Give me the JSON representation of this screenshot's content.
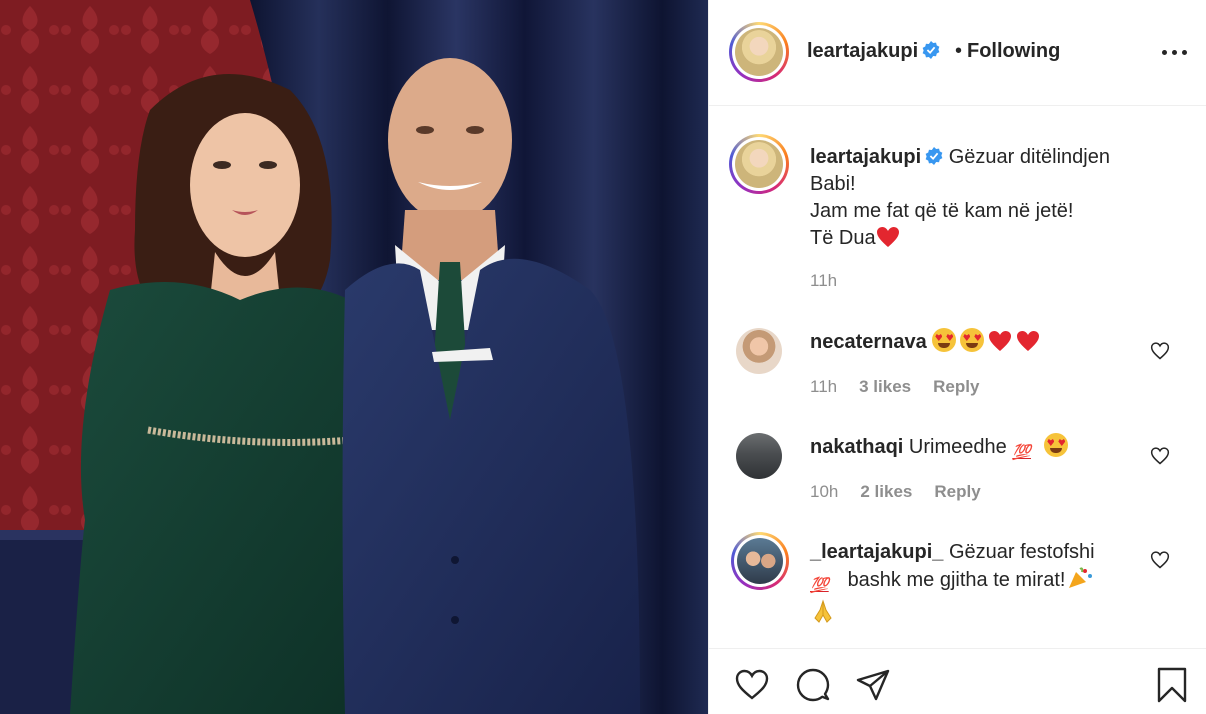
{
  "post": {
    "author": "leartajakupi",
    "follow_status": "Following",
    "separator": "•"
  },
  "caption": {
    "username": "leartajakupi",
    "lines": [
      "Gëzuar ditëlindjen",
      "Babi!",
      "Jam me fat që të kam në jetë!",
      "Të Dua"
    ],
    "time": "11h"
  },
  "comments": [
    {
      "username": "necaternava",
      "text": "",
      "time": "11h",
      "likes": "3 likes",
      "reply": "Reply"
    },
    {
      "username": "nakathaqi",
      "text": "Urimeedhe",
      "time": "10h",
      "likes": "2 likes",
      "reply": "Reply"
    },
    {
      "username": "_leartajakupi_",
      "text": "Gëzuar festofshi",
      "text2": "bashk me gjitha te mirat!",
      "time": "",
      "likes": "",
      "reply": ""
    }
  ],
  "emoji": {
    "hundred": "💯"
  },
  "icons": {
    "more": "more-options-icon",
    "verified": "verified-badge-icon",
    "like": "heart-icon",
    "comment": "comment-bubble-icon",
    "share": "paper-plane-icon",
    "save": "bookmark-icon"
  },
  "colors": {
    "verified": "#3897f0",
    "love": "#e3262f",
    "muted": "#8e8e8e",
    "text": "#262626"
  }
}
